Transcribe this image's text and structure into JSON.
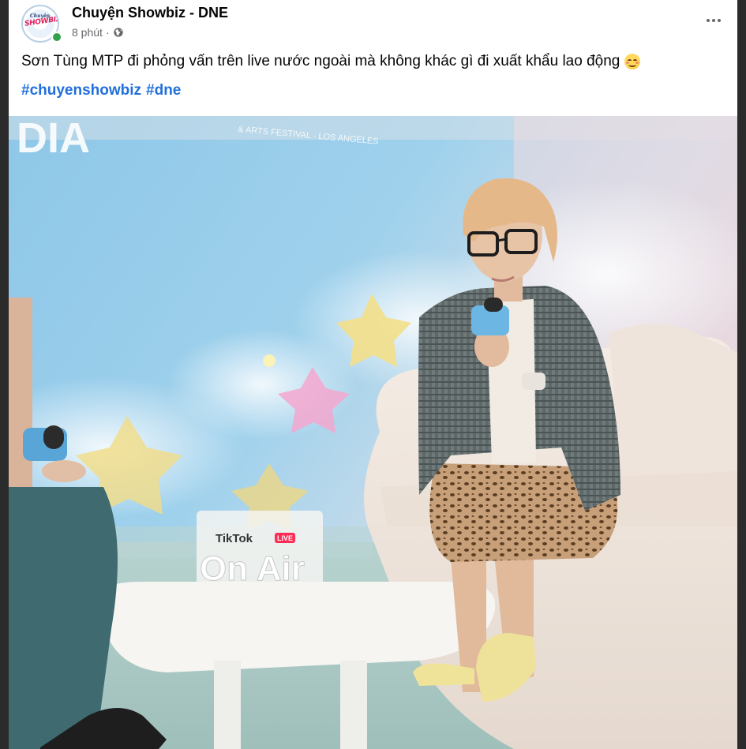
{
  "post": {
    "page_name": "Chuyện Showbiz - DNE",
    "time": "8 phút",
    "separator": "·",
    "privacy_icon": "globe-icon",
    "menu_icon": "more-horizontal-icon",
    "avatar_text_top": "Chuyện",
    "avatar_text_logo": "SHOWBIZ",
    "text": "Sơn Tùng MTP đi phỏng vấn trên live nước ngoài mà không khác gì đi xuất khẩu lao động",
    "emoji": "smiling-face-emoji",
    "hashtags": [
      "#chuyenshowbiz",
      "#dne"
    ]
  },
  "photo": {
    "banner_fragment": "DIA",
    "banner_subtitle": "& ARTS FESTIVAL · LOS ANGELES",
    "sign_brand": "TikTok",
    "sign_live_badge": "LIVE",
    "sign_text": "On Air"
  },
  "colors": {
    "background": "#2b2b2b",
    "card": "#ffffff",
    "name": "#050505",
    "meta": "#65676b",
    "hashtag": "#216fdb",
    "online": "#31a24c"
  }
}
